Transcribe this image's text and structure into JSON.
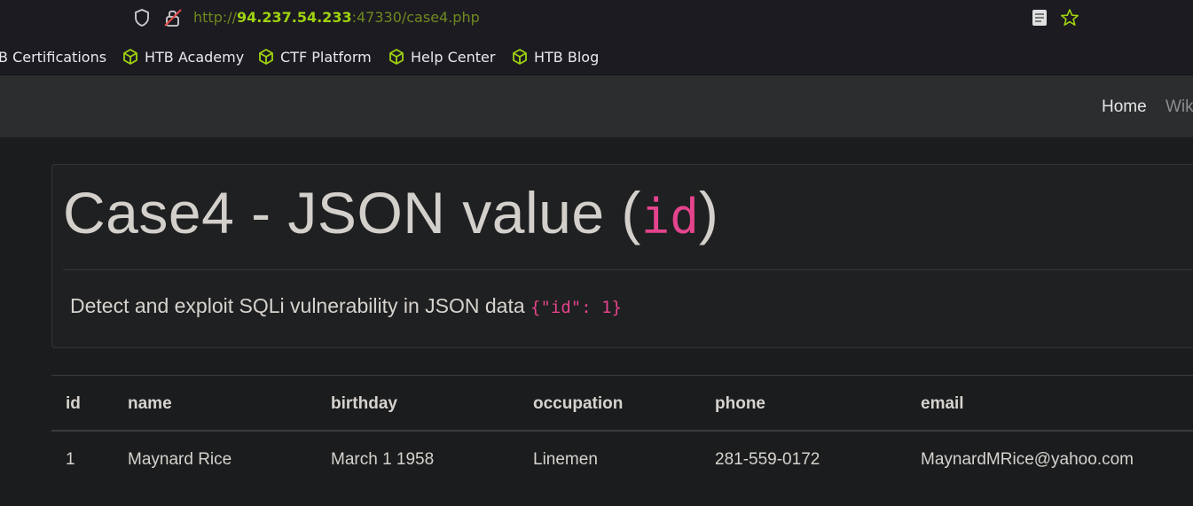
{
  "browser": {
    "url_prefix": "http://",
    "url_host": "94.237.54.233",
    "url_rest": ":47330/case4.php"
  },
  "bookmarks": [
    {
      "label": "B Certifications",
      "icon": null
    },
    {
      "label": "HTB Academy",
      "icon": "htb-cube-icon"
    },
    {
      "label": "CTF Platform",
      "icon": "htb-cube-icon"
    },
    {
      "label": "Help Center",
      "icon": "htb-cube-icon"
    },
    {
      "label": "HTB Blog",
      "icon": "htb-cube-icon"
    }
  ],
  "nav": {
    "home": "Home",
    "wiki": "Wik"
  },
  "header": {
    "title_text": "Case4 - JSON value (",
    "title_code": "id",
    "title_close": ")",
    "description": "Detect and exploit SQLi vulnerability in JSON data ",
    "description_code": "{\"id\": 1}"
  },
  "table": {
    "columns": [
      "id",
      "name",
      "birthday",
      "occupation",
      "phone",
      "email"
    ],
    "rows": [
      [
        "1",
        "Maynard Rice",
        "March 1 1958",
        "Linemen",
        "281-559-0172",
        "MaynardMRice@yahoo.com"
      ]
    ]
  },
  "colors": {
    "accent_green": "#9fd20f",
    "code_pink": "#e4448d",
    "background": "#1b1c1d"
  }
}
